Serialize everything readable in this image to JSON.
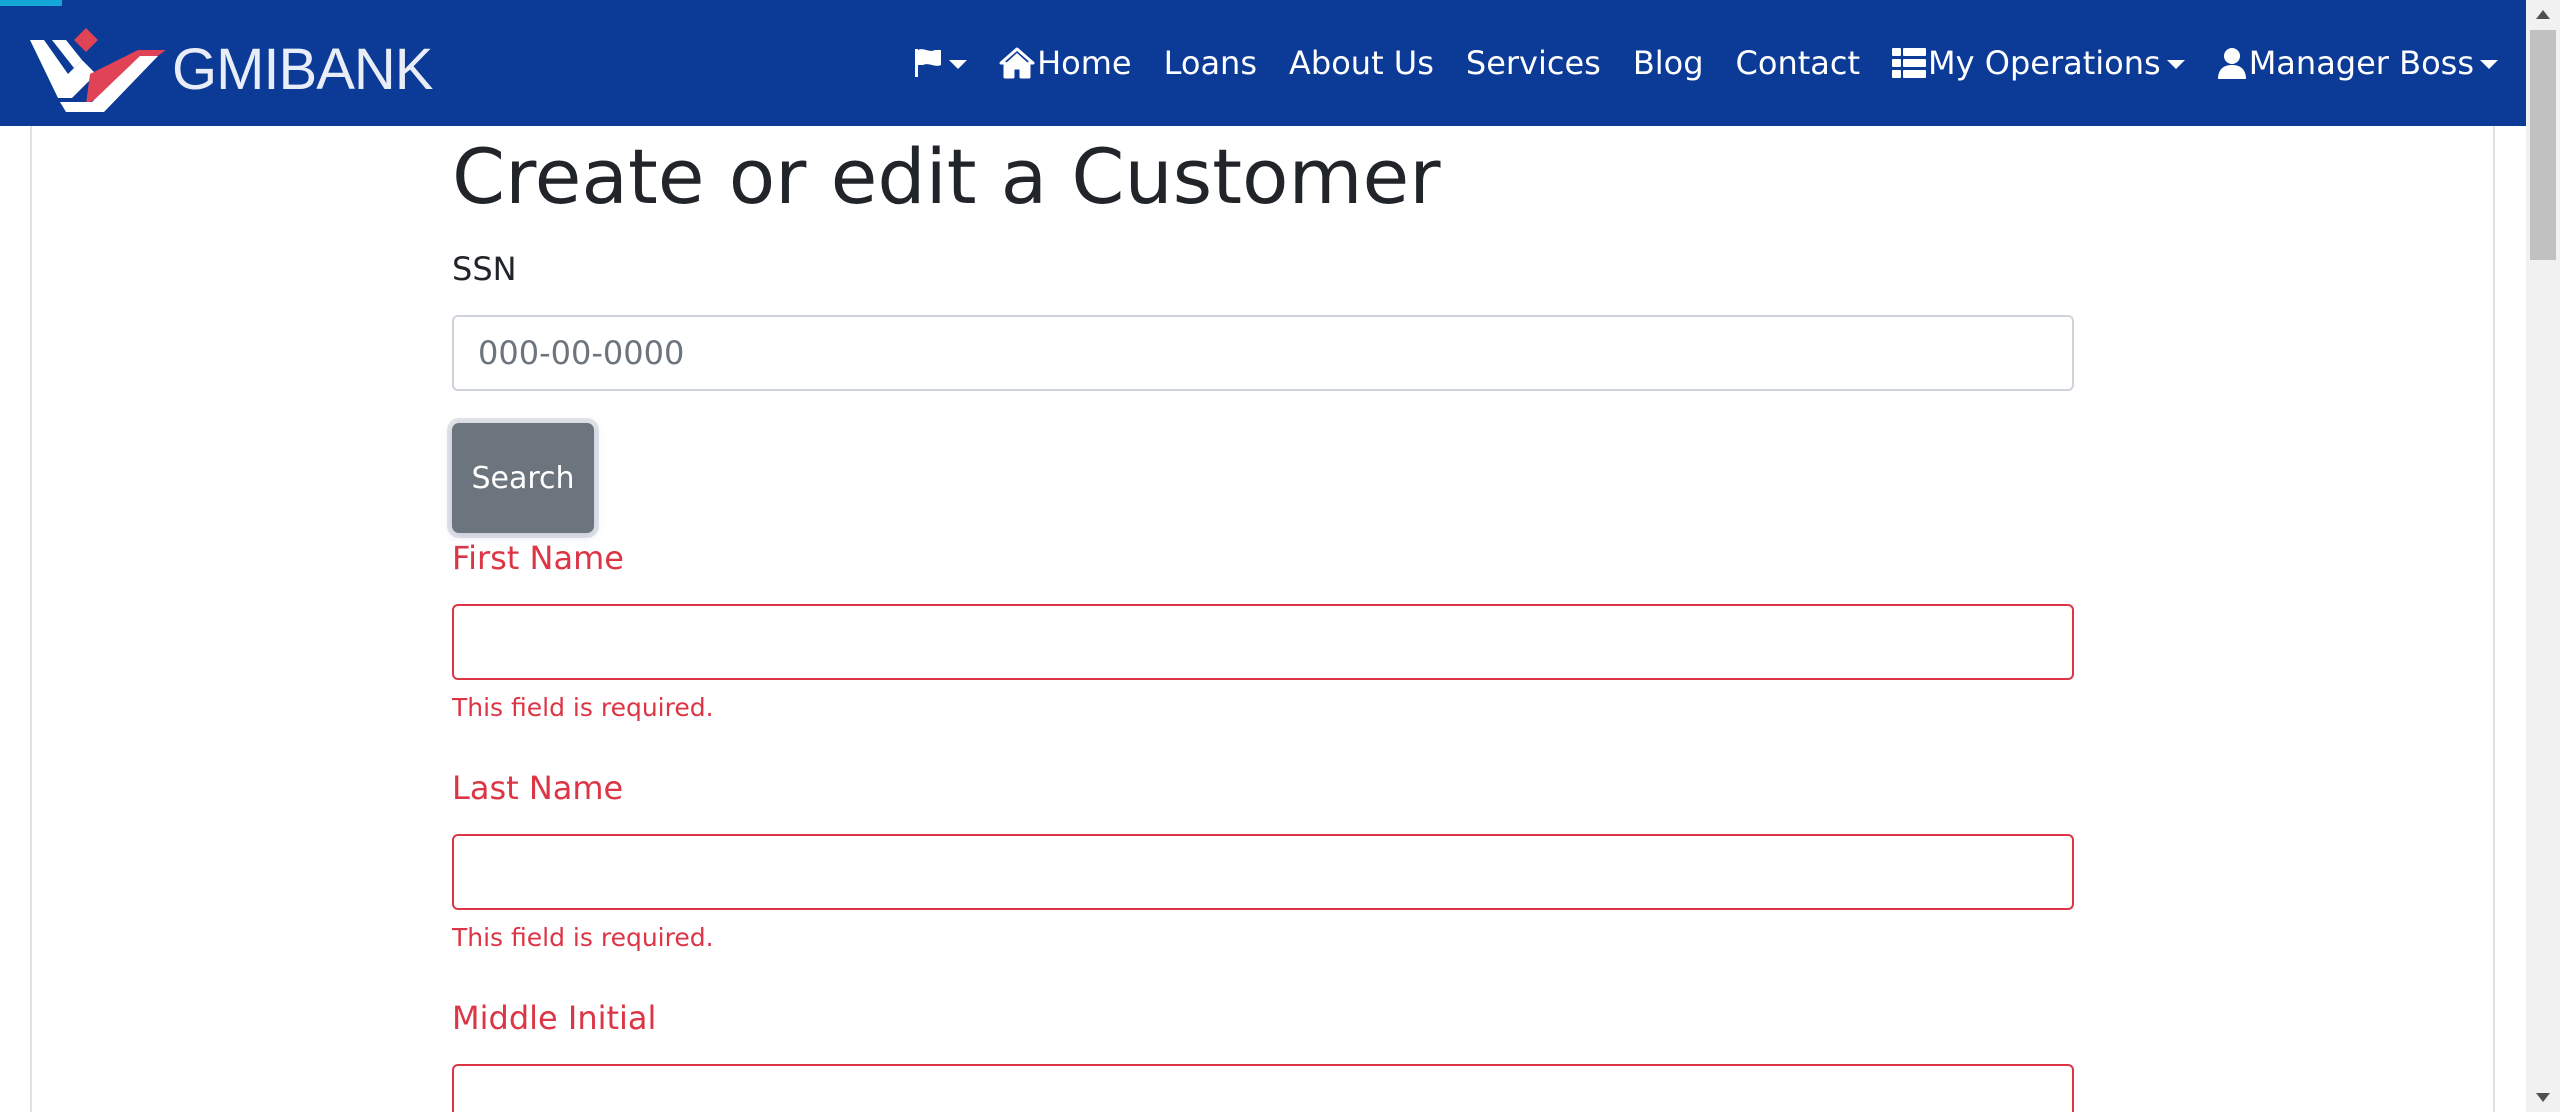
{
  "navbar": {
    "brand": "GMIBANK",
    "items": {
      "language": {
        "icon": "flag-icon"
      },
      "home": {
        "label": "Home",
        "icon": "home-icon"
      },
      "loans": {
        "label": "Loans"
      },
      "about": {
        "label": "About Us"
      },
      "services": {
        "label": "Services"
      },
      "blog": {
        "label": "Blog"
      },
      "contact": {
        "label": "Contact"
      },
      "operations": {
        "label": "My Operations",
        "icon": "list-icon"
      },
      "account": {
        "label": "Manager Boss",
        "icon": "user-icon"
      }
    }
  },
  "form": {
    "title": "Create or edit a Customer",
    "ssn": {
      "label": "SSN",
      "placeholder": "000-00-0000",
      "value": ""
    },
    "search_button": "Search",
    "first_name": {
      "label": "First Name",
      "value": "",
      "error": "This field is required."
    },
    "last_name": {
      "label": "Last Name",
      "value": "",
      "error": "This field is required."
    },
    "middle_initial": {
      "label": "Middle Initial",
      "value": ""
    }
  },
  "colors": {
    "navbar": "#0b3a97",
    "accent": "#15a6d8",
    "danger": "#dc3545",
    "secondary_button": "#6c757d",
    "logo_red": "#e04356"
  }
}
